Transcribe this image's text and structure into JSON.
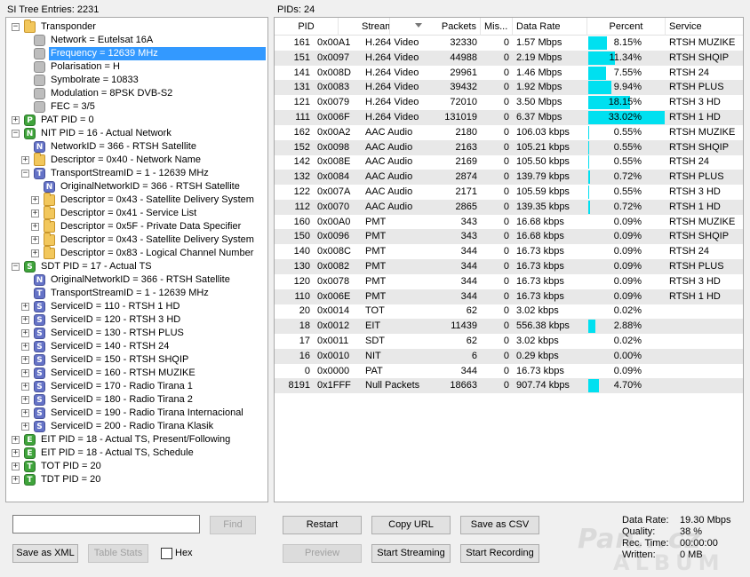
{
  "tree_panel": {
    "title": "SI Tree Entries: 2231"
  },
  "pid_panel": {
    "title": "PIDs: 24"
  },
  "tree": [
    {
      "depth": 0,
      "exp": "−",
      "icon": "folder",
      "icon_name": "folder-icon",
      "letter": "",
      "label": "Transponder"
    },
    {
      "depth": 1,
      "exp": "",
      "icon": "gray",
      "icon_name": "property-icon",
      "letter": "",
      "label": "Network = Eutelsat 16A"
    },
    {
      "depth": 1,
      "exp": "",
      "icon": "gray",
      "icon_name": "property-icon",
      "letter": "",
      "label": "Frequency = 12639 MHz",
      "selected": true
    },
    {
      "depth": 1,
      "exp": "",
      "icon": "gray",
      "icon_name": "property-icon",
      "letter": "",
      "label": "Polarisation = H"
    },
    {
      "depth": 1,
      "exp": "",
      "icon": "gray",
      "icon_name": "property-icon",
      "letter": "",
      "label": "Symbolrate = 10833"
    },
    {
      "depth": 1,
      "exp": "",
      "icon": "gray",
      "icon_name": "property-icon",
      "letter": "",
      "label": "Modulation = 8PSK DVB-S2"
    },
    {
      "depth": 1,
      "exp": "",
      "icon": "gray",
      "icon_name": "property-icon",
      "letter": "",
      "label": "FEC = 3/5"
    },
    {
      "depth": 0,
      "exp": "+",
      "icon": "green",
      "icon_name": "pat-table-icon",
      "letter": "P",
      "label": "PAT PID = 0"
    },
    {
      "depth": 0,
      "exp": "−",
      "icon": "green",
      "icon_name": "nit-table-icon",
      "letter": "N",
      "label": "NIT PID = 16 - Actual Network"
    },
    {
      "depth": 1,
      "exp": "",
      "icon": "blue",
      "icon_name": "network-id-icon",
      "letter": "N",
      "label": "NetworkID = 366 - RTSH Satellite"
    },
    {
      "depth": 1,
      "exp": "+",
      "icon": "folder",
      "icon_name": "folder-icon",
      "letter": "",
      "label": "Descriptor = 0x40 - Network Name"
    },
    {
      "depth": 1,
      "exp": "−",
      "icon": "blue",
      "icon_name": "transport-stream-icon",
      "letter": "T",
      "label": "TransportStreamID = 1 - 12639 MHz"
    },
    {
      "depth": 2,
      "exp": "",
      "icon": "blue",
      "icon_name": "network-id-icon",
      "letter": "N",
      "label": "OriginalNetworkID = 366 - RTSH Satellite"
    },
    {
      "depth": 2,
      "exp": "+",
      "icon": "folder",
      "icon_name": "folder-icon",
      "letter": "",
      "label": "Descriptor = 0x43 - Satellite Delivery System"
    },
    {
      "depth": 2,
      "exp": "+",
      "icon": "folder",
      "icon_name": "folder-icon",
      "letter": "",
      "label": "Descriptor = 0x41 - Service List"
    },
    {
      "depth": 2,
      "exp": "+",
      "icon": "folder",
      "icon_name": "folder-icon",
      "letter": "",
      "label": "Descriptor = 0x5F - Private Data Specifier"
    },
    {
      "depth": 2,
      "exp": "+",
      "icon": "folder",
      "icon_name": "folder-icon",
      "letter": "",
      "label": "Descriptor = 0x43 - Satellite Delivery System"
    },
    {
      "depth": 2,
      "exp": "+",
      "icon": "folder",
      "icon_name": "folder-icon",
      "letter": "",
      "label": "Descriptor = 0x83 - Logical Channel Number"
    },
    {
      "depth": 0,
      "exp": "−",
      "icon": "green",
      "icon_name": "sdt-table-icon",
      "letter": "S",
      "label": "SDT PID = 17 - Actual TS"
    },
    {
      "depth": 1,
      "exp": "",
      "icon": "blue",
      "icon_name": "network-id-icon",
      "letter": "N",
      "label": "OriginalNetworkID = 366 - RTSH Satellite"
    },
    {
      "depth": 1,
      "exp": "",
      "icon": "blue",
      "icon_name": "transport-stream-icon",
      "letter": "T",
      "label": "TransportStreamID = 1 - 12639 MHz"
    },
    {
      "depth": 1,
      "exp": "+",
      "icon": "blue",
      "icon_name": "service-icon",
      "letter": "S",
      "label": "ServiceID = 110 - RTSH 1 HD"
    },
    {
      "depth": 1,
      "exp": "+",
      "icon": "blue",
      "icon_name": "service-icon",
      "letter": "S",
      "label": "ServiceID = 120 - RTSH 3 HD"
    },
    {
      "depth": 1,
      "exp": "+",
      "icon": "blue",
      "icon_name": "service-icon",
      "letter": "S",
      "label": "ServiceID = 130 - RTSH PLUS"
    },
    {
      "depth": 1,
      "exp": "+",
      "icon": "blue",
      "icon_name": "service-icon",
      "letter": "S",
      "label": "ServiceID = 140 - RTSH 24"
    },
    {
      "depth": 1,
      "exp": "+",
      "icon": "blue",
      "icon_name": "service-icon",
      "letter": "S",
      "label": "ServiceID = 150 - RTSH SHQIP"
    },
    {
      "depth": 1,
      "exp": "+",
      "icon": "blue",
      "icon_name": "service-icon",
      "letter": "S",
      "label": "ServiceID = 160 - RTSH MUZIKE"
    },
    {
      "depth": 1,
      "exp": "+",
      "icon": "blue",
      "icon_name": "service-icon",
      "letter": "S",
      "label": "ServiceID = 170 - Radio Tirana 1"
    },
    {
      "depth": 1,
      "exp": "+",
      "icon": "blue",
      "icon_name": "service-icon",
      "letter": "S",
      "label": "ServiceID = 180 - Radio Tirana 2"
    },
    {
      "depth": 1,
      "exp": "+",
      "icon": "blue",
      "icon_name": "service-icon",
      "letter": "S",
      "label": "ServiceID = 190 - Radio Tirana Internacional"
    },
    {
      "depth": 1,
      "exp": "+",
      "icon": "blue",
      "icon_name": "service-icon",
      "letter": "S",
      "label": "ServiceID = 200 - Radio Tirana Klasik"
    },
    {
      "depth": 0,
      "exp": "+",
      "icon": "green",
      "icon_name": "eit-table-icon",
      "letter": "E",
      "label": "EIT PID = 18 - Actual TS, Present/Following"
    },
    {
      "depth": 0,
      "exp": "+",
      "icon": "green",
      "icon_name": "eit-table-icon",
      "letter": "E",
      "label": "EIT PID = 18 - Actual TS, Schedule"
    },
    {
      "depth": 0,
      "exp": "+",
      "icon": "green",
      "icon_name": "tot-table-icon",
      "letter": "T",
      "label": "TOT PID = 20"
    },
    {
      "depth": 0,
      "exp": "+",
      "icon": "green",
      "icon_name": "tdt-table-icon",
      "letter": "T",
      "label": "TDT PID = 20"
    }
  ],
  "table": {
    "headers": [
      "PID",
      "Stream ...",
      "Packets",
      "Mis...",
      "Data Rate",
      "Percent",
      "Service"
    ],
    "sort_icon": "sort-desc-icon",
    "rows": [
      {
        "pid": "161",
        "hex": "0x00A1",
        "stream": "H.264 Video",
        "packets": "32330",
        "mis": "0",
        "rate": "1.57 Mbps",
        "percent": "8.15%",
        "pct": 8.15,
        "service": "RTSH MUZIKE"
      },
      {
        "pid": "151",
        "hex": "0x0097",
        "stream": "H.264 Video",
        "packets": "44988",
        "mis": "0",
        "rate": "2.19 Mbps",
        "percent": "11.34%",
        "pct": 11.34,
        "service": "RTSH SHQIP"
      },
      {
        "pid": "141",
        "hex": "0x008D",
        "stream": "H.264 Video",
        "packets": "29961",
        "mis": "0",
        "rate": "1.46 Mbps",
        "percent": "7.55%",
        "pct": 7.55,
        "service": "RTSH 24"
      },
      {
        "pid": "131",
        "hex": "0x0083",
        "stream": "H.264 Video",
        "packets": "39432",
        "mis": "0",
        "rate": "1.92 Mbps",
        "percent": "9.94%",
        "pct": 9.94,
        "service": "RTSH PLUS"
      },
      {
        "pid": "121",
        "hex": "0x0079",
        "stream": "H.264 Video",
        "packets": "72010",
        "mis": "0",
        "rate": "3.50 Mbps",
        "percent": "18.15%",
        "pct": 18.15,
        "service": "RTSH 3 HD"
      },
      {
        "pid": "111",
        "hex": "0x006F",
        "stream": "H.264 Video",
        "packets": "131019",
        "mis": "0",
        "rate": "6.37 Mbps",
        "percent": "33.02%",
        "pct": 33.02,
        "service": "RTSH 1 HD"
      },
      {
        "pid": "162",
        "hex": "0x00A2",
        "stream": "AAC Audio",
        "packets": "2180",
        "mis": "0",
        "rate": "106.03 kbps",
        "percent": "0.55%",
        "pct": 0.55,
        "service": "RTSH MUZIKE"
      },
      {
        "pid": "152",
        "hex": "0x0098",
        "stream": "AAC Audio",
        "packets": "2163",
        "mis": "0",
        "rate": "105.21 kbps",
        "percent": "0.55%",
        "pct": 0.55,
        "service": "RTSH SHQIP"
      },
      {
        "pid": "142",
        "hex": "0x008E",
        "stream": "AAC Audio",
        "packets": "2169",
        "mis": "0",
        "rate": "105.50 kbps",
        "percent": "0.55%",
        "pct": 0.55,
        "service": "RTSH 24"
      },
      {
        "pid": "132",
        "hex": "0x0084",
        "stream": "AAC Audio",
        "packets": "2874",
        "mis": "0",
        "rate": "139.79 kbps",
        "percent": "0.72%",
        "pct": 0.72,
        "service": "RTSH PLUS"
      },
      {
        "pid": "122",
        "hex": "0x007A",
        "stream": "AAC Audio",
        "packets": "2171",
        "mis": "0",
        "rate": "105.59 kbps",
        "percent": "0.55%",
        "pct": 0.55,
        "service": "RTSH 3 HD"
      },
      {
        "pid": "112",
        "hex": "0x0070",
        "stream": "AAC Audio",
        "packets": "2865",
        "mis": "0",
        "rate": "139.35 kbps",
        "percent": "0.72%",
        "pct": 0.72,
        "service": "RTSH 1 HD"
      },
      {
        "pid": "160",
        "hex": "0x00A0",
        "stream": "PMT",
        "packets": "343",
        "mis": "0",
        "rate": "16.68 kbps",
        "percent": "0.09%",
        "pct": 0.09,
        "service": "RTSH MUZIKE"
      },
      {
        "pid": "150",
        "hex": "0x0096",
        "stream": "PMT",
        "packets": "343",
        "mis": "0",
        "rate": "16.68 kbps",
        "percent": "0.09%",
        "pct": 0.09,
        "service": "RTSH SHQIP"
      },
      {
        "pid": "140",
        "hex": "0x008C",
        "stream": "PMT",
        "packets": "344",
        "mis": "0",
        "rate": "16.73 kbps",
        "percent": "0.09%",
        "pct": 0.09,
        "service": "RTSH 24"
      },
      {
        "pid": "130",
        "hex": "0x0082",
        "stream": "PMT",
        "packets": "344",
        "mis": "0",
        "rate": "16.73 kbps",
        "percent": "0.09%",
        "pct": 0.09,
        "service": "RTSH PLUS"
      },
      {
        "pid": "120",
        "hex": "0x0078",
        "stream": "PMT",
        "packets": "344",
        "mis": "0",
        "rate": "16.73 kbps",
        "percent": "0.09%",
        "pct": 0.09,
        "service": "RTSH 3 HD"
      },
      {
        "pid": "110",
        "hex": "0x006E",
        "stream": "PMT",
        "packets": "344",
        "mis": "0",
        "rate": "16.73 kbps",
        "percent": "0.09%",
        "pct": 0.09,
        "service": "RTSH 1 HD"
      },
      {
        "pid": "20",
        "hex": "0x0014",
        "stream": "TOT",
        "packets": "62",
        "mis": "0",
        "rate": "3.02 kbps",
        "percent": "0.02%",
        "pct": 0.02,
        "service": ""
      },
      {
        "pid": "18",
        "hex": "0x0012",
        "stream": "EIT",
        "packets": "11439",
        "mis": "0",
        "rate": "556.38 kbps",
        "percent": "2.88%",
        "pct": 2.88,
        "service": ""
      },
      {
        "pid": "17",
        "hex": "0x0011",
        "stream": "SDT",
        "packets": "62",
        "mis": "0",
        "rate": "3.02 kbps",
        "percent": "0.02%",
        "pct": 0.02,
        "service": ""
      },
      {
        "pid": "16",
        "hex": "0x0010",
        "stream": "NIT",
        "packets": "6",
        "mis": "0",
        "rate": "0.29 kbps",
        "percent": "0.00%",
        "pct": 0.0,
        "service": ""
      },
      {
        "pid": "0",
        "hex": "0x0000",
        "stream": "PAT",
        "packets": "344",
        "mis": "0",
        "rate": "16.73 kbps",
        "percent": "0.09%",
        "pct": 0.09,
        "service": ""
      },
      {
        "pid": "8191",
        "hex": "0x1FFF",
        "stream": "Null Packets",
        "packets": "18663",
        "mis": "0",
        "rate": "907.74 kbps",
        "percent": "4.70%",
        "pct": 4.7,
        "service": ""
      }
    ]
  },
  "search": {
    "value": "",
    "find_label": "Find"
  },
  "buttons": {
    "save_xml": "Save as XML",
    "table_stats": "Table Stats",
    "hex": "Hex",
    "restart": "Restart",
    "copy_url": "Copy URL",
    "save_csv": "Save as CSV",
    "preview": "Preview",
    "start_streaming": "Start Streaming",
    "start_recording": "Start Recording"
  },
  "stats": [
    {
      "label": "Data Rate:",
      "value": "19.30 Mbps"
    },
    {
      "label": "Quality:",
      "value": "38 %"
    },
    {
      "label": "Rec. Time:",
      "value": "00:00:00"
    },
    {
      "label": "Written:",
      "value": "0 MB"
    }
  ],
  "watermark": {
    "line1": "Pan...cz",
    "line2": "ALBUM"
  },
  "colors": {
    "selection": "#3399ff",
    "bar": "#00e0f0",
    "alt_row": "#e8e8e8"
  }
}
